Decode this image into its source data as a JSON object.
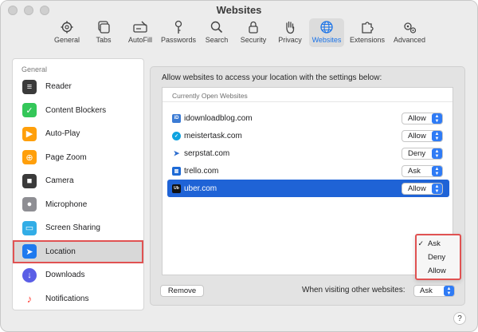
{
  "window": {
    "title": "Websites"
  },
  "toolbar": {
    "items": [
      {
        "label": "General",
        "icon": "gear-icon"
      },
      {
        "label": "Tabs",
        "icon": "tabs-icon"
      },
      {
        "label": "AutoFill",
        "icon": "autofill-icon"
      },
      {
        "label": "Passwords",
        "icon": "key-icon"
      },
      {
        "label": "Search",
        "icon": "search-icon"
      },
      {
        "label": "Security",
        "icon": "lock-icon"
      },
      {
        "label": "Privacy",
        "icon": "hand-icon"
      },
      {
        "label": "Websites",
        "icon": "globe-icon",
        "active": true
      },
      {
        "label": "Extensions",
        "icon": "puzzle-icon"
      },
      {
        "label": "Advanced",
        "icon": "gears-icon"
      }
    ]
  },
  "sidebar": {
    "header": "General",
    "items": [
      {
        "label": "Reader",
        "icon": "reader-icon",
        "color": "#3a3a3a"
      },
      {
        "label": "Content Blockers",
        "icon": "checkmark-shield-icon",
        "color": "#34c759"
      },
      {
        "label": "Auto-Play",
        "icon": "play-icon",
        "color": "#ff9f0a"
      },
      {
        "label": "Page Zoom",
        "icon": "zoom-icon",
        "color": "#ff9f0a"
      },
      {
        "label": "Camera",
        "icon": "camera-icon",
        "color": "#3a3a3a"
      },
      {
        "label": "Microphone",
        "icon": "microphone-icon",
        "color": "#8e8e93"
      },
      {
        "label": "Screen Sharing",
        "icon": "screen-sharing-icon",
        "color": "#32ade6"
      },
      {
        "label": "Location",
        "icon": "location-arrow-icon",
        "color": "#1f7aef",
        "selected": true
      },
      {
        "label": "Downloads",
        "icon": "download-icon",
        "color": "#5a5ee6"
      },
      {
        "label": "Notifications",
        "icon": "bell-icon",
        "color": "#ff3b30"
      }
    ]
  },
  "main": {
    "description": "Allow websites to access your location with the settings below:",
    "list_header": "Currently Open Websites",
    "sites": [
      {
        "name": "idownloadblog.com",
        "setting": "Allow",
        "fav_color": "#3b7bd4",
        "fav_text": "iD"
      },
      {
        "name": "meistertask.com",
        "setting": "Allow",
        "fav_color": "#0fa3e0",
        "fav_text": "✓"
      },
      {
        "name": "serpstat.com",
        "setting": "Deny",
        "fav_color": "#2d6ecf",
        "fav_text": "➤"
      },
      {
        "name": "trello.com",
        "setting": "Ask",
        "fav_color": "#1d6ad6",
        "fav_text": "▥"
      },
      {
        "name": "uber.com",
        "setting": "Allow",
        "fav_color": "#111111",
        "fav_text": "Ub",
        "selected": true
      }
    ],
    "dropdown_menu": {
      "options": [
        "Ask",
        "Deny",
        "Allow"
      ],
      "checked": "Ask"
    },
    "remove_label": "Remove",
    "other_websites_label": "When visiting other websites:",
    "other_websites_value": "Ask",
    "help_label": "?"
  }
}
